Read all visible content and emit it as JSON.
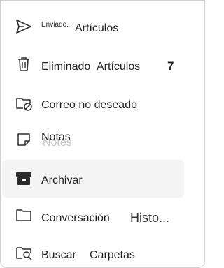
{
  "folders": {
    "sent": {
      "label_small": "Enviado.",
      "label": "Artículos",
      "icon": "send-icon"
    },
    "deleted": {
      "label_a": "Eliminado",
      "label_b": "Artículos",
      "count": "7",
      "icon": "trash-icon"
    },
    "junk": {
      "label": "Correo no deseado",
      "icon": "folder-blocked-icon"
    },
    "notes": {
      "label": "Notas",
      "ghost": "Notes",
      "icon": "note-icon"
    },
    "archive": {
      "label": "Archivar",
      "icon": "archive-icon"
    },
    "conversation": {
      "label": "Conversación",
      "extra": "Histo...",
      "icon": "folder-icon"
    },
    "search": {
      "label_a": "Buscar",
      "label_b": "Carpetas",
      "icon": "folder-search-icon"
    }
  }
}
